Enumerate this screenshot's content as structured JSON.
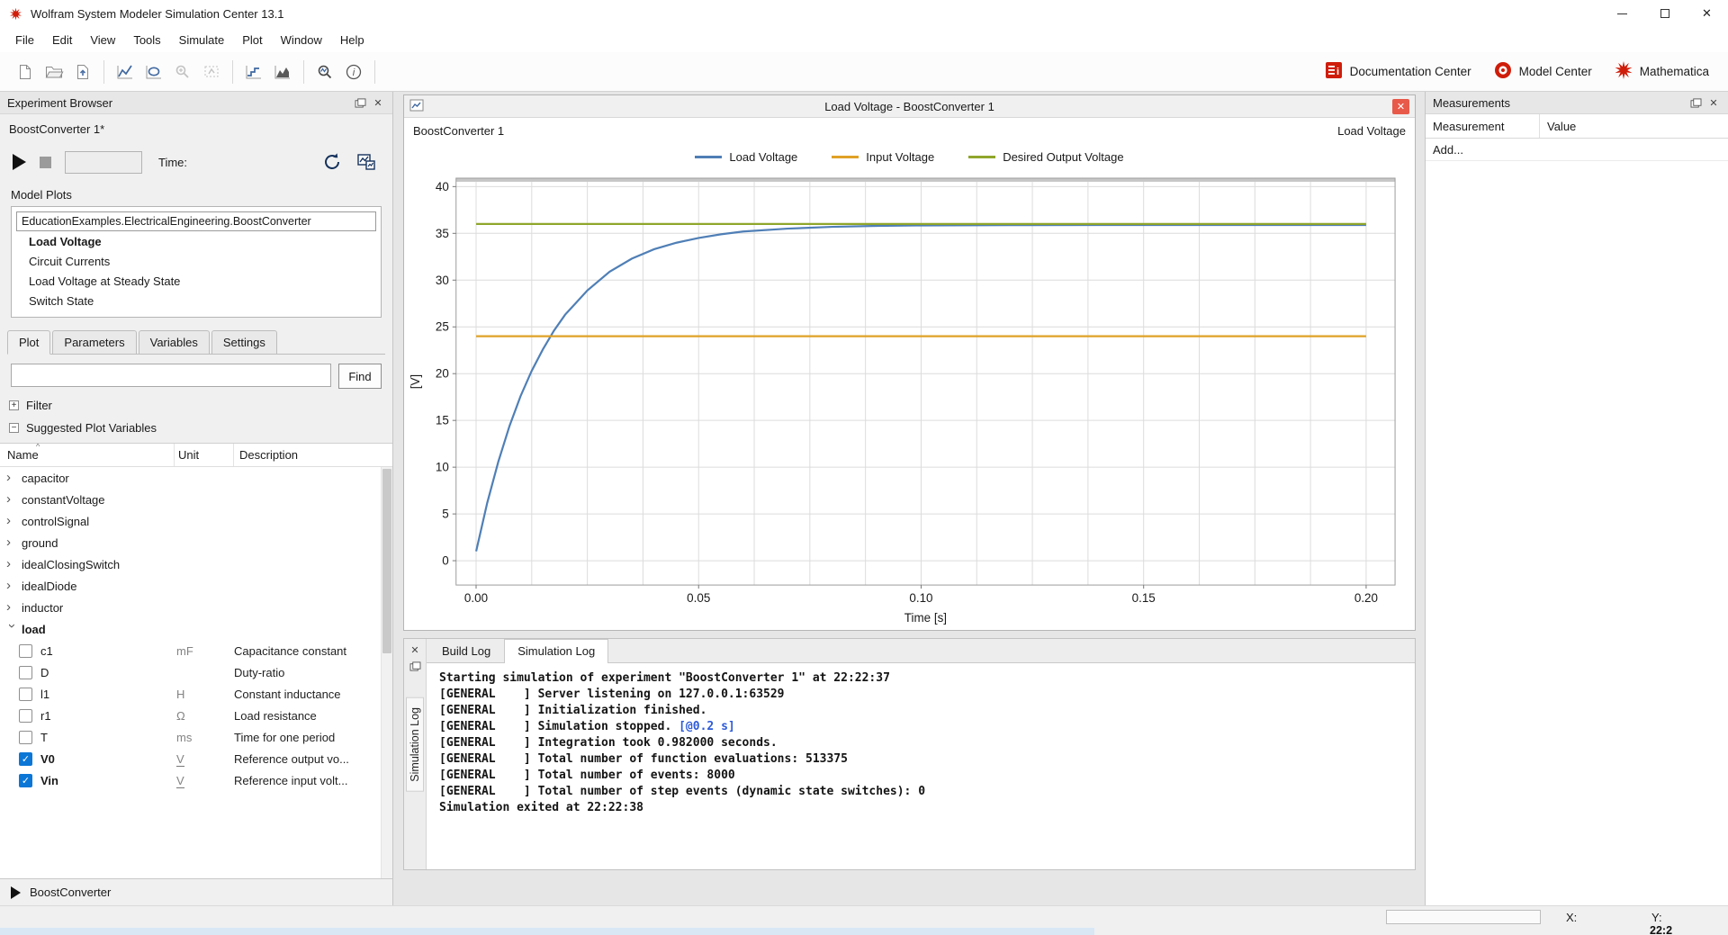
{
  "window": {
    "title": "Wolfram System Modeler Simulation Center 13.1"
  },
  "menu": {
    "items": [
      "File",
      "Edit",
      "View",
      "Tools",
      "Simulate",
      "Plot",
      "Window",
      "Help"
    ]
  },
  "toolbar": {
    "right": [
      {
        "label": "Documentation Center",
        "icon": "documentation-center-icon"
      },
      {
        "label": "Model Center",
        "icon": "model-center-icon"
      },
      {
        "label": "Mathematica",
        "icon": "mathematica-icon"
      }
    ]
  },
  "experiment_browser": {
    "title": "Experiment Browser",
    "experiment_name": "BoostConverter 1*",
    "time_label": "Time:",
    "time_value": "",
    "model_plots_label": "Model Plots",
    "model_path": "EducationExamples.ElectricalEngineering.BoostConverter",
    "plots": [
      "Load Voltage",
      "Circuit Currents",
      "Load Voltage at Steady State",
      "Switch State"
    ],
    "selected_plot": "Load Voltage",
    "tabs": [
      "Plot",
      "Parameters",
      "Variables",
      "Settings"
    ],
    "active_tab": "Plot",
    "search_value": "",
    "find_label": "Find",
    "filter_label": "Filter",
    "suggested_label": "Suggested Plot Variables",
    "columns": [
      "Name",
      "Unit",
      "Description"
    ],
    "rows": [
      {
        "kind": "parent",
        "name": "capacitor"
      },
      {
        "kind": "parent",
        "name": "constantVoltage"
      },
      {
        "kind": "parent",
        "name": "controlSignal"
      },
      {
        "kind": "parent",
        "name": "ground"
      },
      {
        "kind": "parent",
        "name": "idealClosingSwitch"
      },
      {
        "kind": "parent",
        "name": "idealDiode"
      },
      {
        "kind": "parent",
        "name": "inductor"
      },
      {
        "kind": "parent",
        "name": "load",
        "expanded": true,
        "bold": true
      },
      {
        "kind": "child",
        "name": "c1",
        "unit": "mF",
        "desc": "Capacitance constant",
        "checked": false
      },
      {
        "kind": "child",
        "name": "D",
        "unit": "",
        "desc": "Duty-ratio",
        "checked": false
      },
      {
        "kind": "child",
        "name": "l1",
        "unit": "H",
        "desc": "Constant inductance",
        "checked": false
      },
      {
        "kind": "child",
        "name": "r1",
        "unit": "Ω",
        "desc": "Load resistance",
        "checked": false
      },
      {
        "kind": "child",
        "name": "T",
        "unit": "ms",
        "desc": "Time for one period",
        "checked": false
      },
      {
        "kind": "child",
        "name": "V0",
        "unit": "V",
        "desc": "Reference output vo...",
        "checked": true,
        "bold": true
      },
      {
        "kind": "child",
        "name": "Vin",
        "unit": "V",
        "desc": "Reference input volt...",
        "checked": true,
        "bold": true
      }
    ],
    "bottom_item": "BoostConverter"
  },
  "plot_window": {
    "title": "Load Voltage - BoostConverter 1",
    "header_left": "BoostConverter 1",
    "header_right": "Load Voltage"
  },
  "chart_data": {
    "type": "line",
    "title": "Load Voltage - BoostConverter 1",
    "xlabel": "Time [s]",
    "ylabel": "[V]",
    "xlim": [
      0,
      0.2
    ],
    "ylim": [
      0,
      40
    ],
    "x_ticks": [
      0,
      0.05,
      0.1,
      0.15,
      0.2
    ],
    "x_tick_labels": [
      "0.00",
      "0.05",
      "0.10",
      "0.15",
      "0.20"
    ],
    "y_ticks": [
      0,
      5,
      10,
      15,
      20,
      25,
      30,
      35,
      40
    ],
    "x_minor_step": 0.0125,
    "grid": true,
    "legend_position": "top",
    "series": [
      {
        "name": "Load Voltage",
        "color": "#4f7fb6",
        "points": [
          [
            0,
            1.0
          ],
          [
            0.0025,
            6.2
          ],
          [
            0.005,
            10.6
          ],
          [
            0.0075,
            14.4
          ],
          [
            0.01,
            17.6
          ],
          [
            0.0125,
            20.3
          ],
          [
            0.015,
            22.6
          ],
          [
            0.0175,
            24.6
          ],
          [
            0.02,
            26.3
          ],
          [
            0.025,
            28.9
          ],
          [
            0.03,
            30.9
          ],
          [
            0.035,
            32.3
          ],
          [
            0.04,
            33.3
          ],
          [
            0.045,
            34.0
          ],
          [
            0.05,
            34.5
          ],
          [
            0.055,
            34.9
          ],
          [
            0.06,
            35.2
          ],
          [
            0.07,
            35.5
          ],
          [
            0.08,
            35.7
          ],
          [
            0.09,
            35.8
          ],
          [
            0.1,
            35.85
          ],
          [
            0.12,
            35.88
          ],
          [
            0.14,
            35.9
          ],
          [
            0.16,
            35.9
          ],
          [
            0.18,
            35.9
          ],
          [
            0.2,
            35.9
          ]
        ]
      },
      {
        "name": "Input Voltage",
        "color": "#dfa126",
        "points": [
          [
            0,
            24
          ],
          [
            0.2,
            24
          ]
        ]
      },
      {
        "name": "Desired Output Voltage",
        "color": "#8fa62b",
        "points": [
          [
            0,
            36
          ],
          [
            0.2,
            36
          ]
        ]
      }
    ]
  },
  "log_panel": {
    "tabs": [
      "Build Log",
      "Simulation Log"
    ],
    "active_tab": "Simulation Log",
    "side_label": "Simulation Log",
    "lines": [
      {
        "text": "Starting simulation of experiment \"BoostConverter 1\" at 22:22:37"
      },
      {
        "text": "[GENERAL    ] Server listening on 127.0.0.1:63529"
      },
      {
        "text": "[GENERAL    ] Initialization finished."
      },
      {
        "text": "[GENERAL    ] Simulation stopped. ",
        "link": "[@0.2 s]"
      },
      {
        "text": "[GENERAL    ] Integration took 0.982000 seconds."
      },
      {
        "text": "[GENERAL    ] Total number of function evaluations: 513375"
      },
      {
        "text": "[GENERAL    ] Total number of events: 8000"
      },
      {
        "text": "[GENERAL    ] Total number of step events (dynamic state switches): 0"
      },
      {
        "text": "Simulation exited at 22:22:38"
      }
    ]
  },
  "measurements": {
    "title": "Measurements",
    "columns": [
      "Measurement",
      "Value"
    ],
    "add_label": "Add..."
  },
  "status_bar": {
    "x_label": "X:",
    "y_label": "Y:"
  },
  "taskbar": {
    "clock_partial": "22:2"
  }
}
